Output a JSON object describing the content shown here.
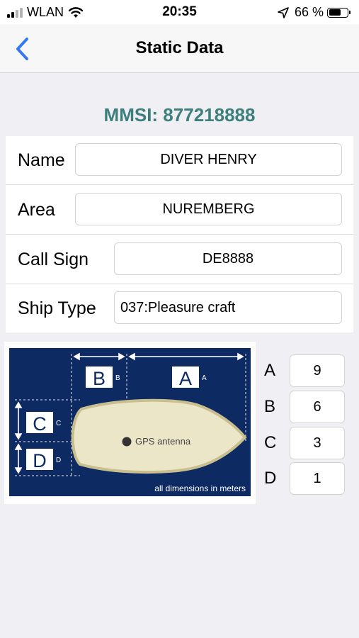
{
  "status_bar": {
    "carrier": "WLAN",
    "time": "20:35",
    "battery_percent": "66 %",
    "battery_level": 0.66,
    "icons": [
      "signal-icon",
      "wifi-icon",
      "location-arrow-icon",
      "battery-icon"
    ]
  },
  "nav": {
    "title": "Static Data",
    "back_icon": "chevron-left-icon"
  },
  "mmsi": "MMSI: 877218888",
  "form": {
    "name_label": "Name",
    "name_value": "DIVER HENRY",
    "area_label": "Area",
    "area_value": "NUREMBERG",
    "call_sign_label": "Call Sign",
    "call_sign_value": "DE8888",
    "ship_type_label": "Ship Type",
    "ship_type_value": "037:Pleasure craft"
  },
  "diagram": {
    "label_a": "A",
    "label_a_small": "A",
    "label_b": "B",
    "label_b_small": "B",
    "label_c": "C",
    "label_c_small": "C",
    "label_d": "D",
    "label_d_small": "D",
    "antenna_label": "GPS antenna",
    "footer": "all dimensions in meters"
  },
  "dimensions": {
    "a_label": "A",
    "a_value": "9",
    "b_label": "B",
    "b_value": "6",
    "c_label": "C",
    "c_value": "3",
    "d_label": "D",
    "d_value": "1"
  },
  "colors": {
    "accent": "#3478f6",
    "mmsi": "#3c7f7d",
    "diagram_bg": "#0e2a63",
    "hull": "#ece6c8"
  }
}
